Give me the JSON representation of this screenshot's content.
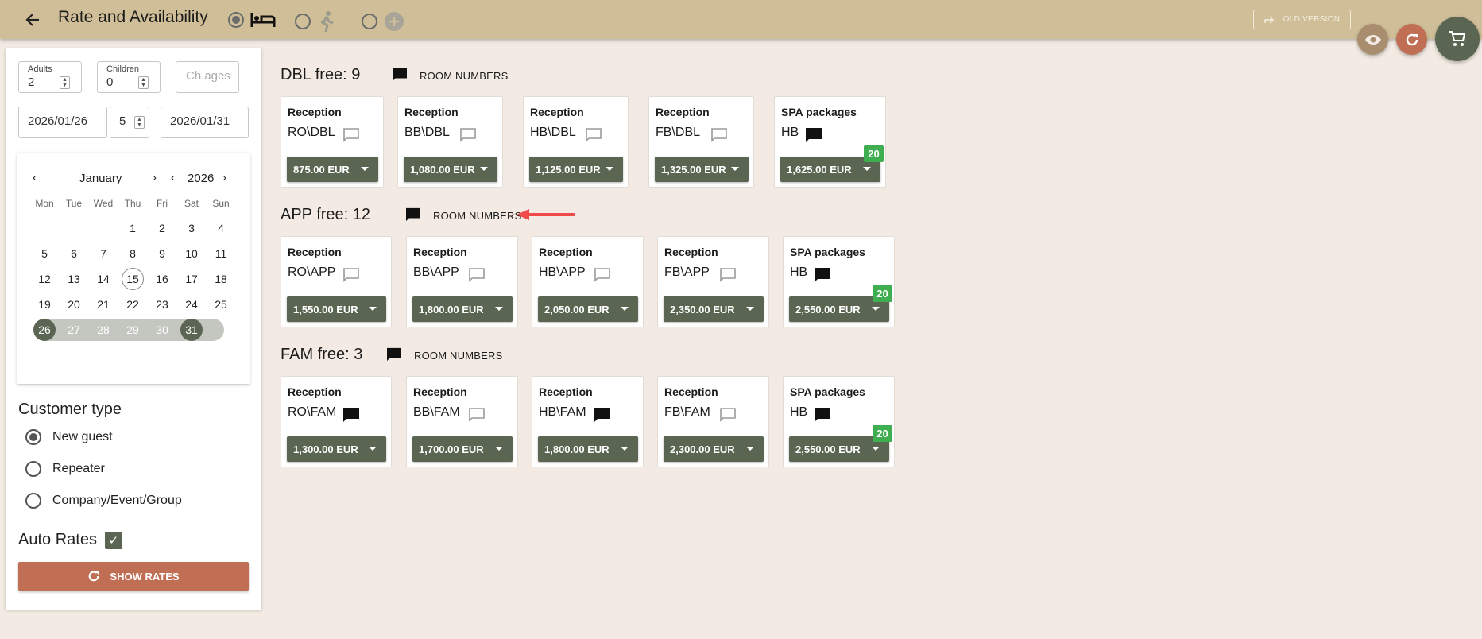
{
  "header": {
    "title": "Rate and Availability",
    "old_version_label": "OLD VERSION"
  },
  "search": {
    "adults_label": "Adults",
    "adults_value": "2",
    "children_label": "Children",
    "children_value": "0",
    "child_ages_placeholder": "Ch.ages",
    "arrival": "2026/01/26",
    "nights": "5",
    "departure": "2026/01/31"
  },
  "calendar": {
    "month": "January",
    "year": "2026",
    "weekdays": [
      "Mon",
      "Tue",
      "Wed",
      "Thu",
      "Fri",
      "Sat",
      "Sun"
    ],
    "days": [
      "1",
      "2",
      "3",
      "4",
      "5",
      "6",
      "7",
      "8",
      "9",
      "10",
      "11",
      "12",
      "13",
      "14",
      "15",
      "16",
      "17",
      "18",
      "19",
      "20",
      "21",
      "22",
      "23",
      "24",
      "25",
      "26",
      "27",
      "28",
      "29",
      "30",
      "31"
    ],
    "today": "15",
    "selected_start": "26",
    "selected_end": "31"
  },
  "customer": {
    "title": "Customer type",
    "options": [
      "New guest",
      "Repeater",
      "Company/Event/Group"
    ],
    "selected": "New guest"
  },
  "auto_rates_label": "Auto Rates",
  "show_rates_label": "SHOW RATES",
  "room_numbers_label": "ROOM NUMBERS",
  "sections": [
    {
      "title": "DBL free: 9",
      "cards": [
        {
          "channel": "Reception",
          "rate": "RO\\DBL",
          "price": "875.00 EUR",
          "note": false
        },
        {
          "channel": "Reception",
          "rate": "BB\\DBL",
          "price": "1,080.00 EUR",
          "note": false
        },
        {
          "channel": "Reception",
          "rate": "HB\\DBL",
          "price": "1,125.00 EUR",
          "note": false
        },
        {
          "channel": "Reception",
          "rate": "FB\\DBL",
          "price": "1,325.00 EUR",
          "note": false
        },
        {
          "channel": "SPA packages",
          "rate": "HB",
          "price": "1,625.00 EUR",
          "note": true,
          "badge": "20"
        }
      ]
    },
    {
      "title": "APP free: 12",
      "cards": [
        {
          "channel": "Reception",
          "rate": "RO\\APP",
          "price": "1,550.00 EUR",
          "note": false
        },
        {
          "channel": "Reception",
          "rate": "BB\\APP",
          "price": "1,800.00 EUR",
          "note": false
        },
        {
          "channel": "Reception",
          "rate": "HB\\APP",
          "price": "2,050.00 EUR",
          "note": false
        },
        {
          "channel": "Reception",
          "rate": "FB\\APP",
          "price": "2,350.00 EUR",
          "note": false
        },
        {
          "channel": "SPA packages",
          "rate": "HB",
          "price": "2,550.00 EUR",
          "note": true,
          "badge": "20"
        }
      ]
    },
    {
      "title": "FAM free: 3",
      "cards": [
        {
          "channel": "Reception",
          "rate": "RO\\FAM",
          "price": "1,300.00 EUR",
          "note": true
        },
        {
          "channel": "Reception",
          "rate": "BB\\FAM",
          "price": "1,700.00 EUR",
          "note": false
        },
        {
          "channel": "Reception",
          "rate": "HB\\FAM",
          "price": "1,800.00 EUR",
          "note": true
        },
        {
          "channel": "Reception",
          "rate": "FB\\FAM",
          "price": "2,300.00 EUR",
          "note": false
        },
        {
          "channel": "SPA packages",
          "rate": "HB",
          "price": "2,550.00 EUR",
          "note": true,
          "badge": "20"
        }
      ]
    }
  ],
  "colors": {
    "header_bg": "#cfbe97",
    "page_bg": "#f3ebe3",
    "price_button": "#5b6652",
    "show_rates": "#c06f55",
    "badge": "#3fae50",
    "annotation_arrow": "#ef4b4b"
  }
}
